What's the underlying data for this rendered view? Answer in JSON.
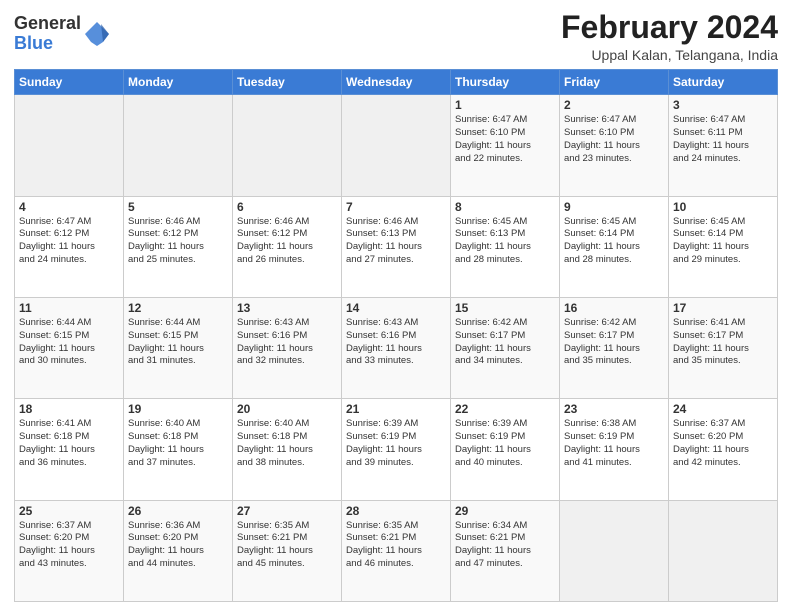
{
  "header": {
    "logo": {
      "general": "General",
      "blue": "Blue"
    },
    "title": "February 2024",
    "subtitle": "Uppal Kalan, Telangana, India"
  },
  "calendar": {
    "days_of_week": [
      "Sunday",
      "Monday",
      "Tuesday",
      "Wednesday",
      "Thursday",
      "Friday",
      "Saturday"
    ],
    "weeks": [
      [
        {
          "day": "",
          "info": ""
        },
        {
          "day": "",
          "info": ""
        },
        {
          "day": "",
          "info": ""
        },
        {
          "day": "",
          "info": ""
        },
        {
          "day": "1",
          "info": "Sunrise: 6:47 AM\nSunset: 6:10 PM\nDaylight: 11 hours\nand 22 minutes."
        },
        {
          "day": "2",
          "info": "Sunrise: 6:47 AM\nSunset: 6:10 PM\nDaylight: 11 hours\nand 23 minutes."
        },
        {
          "day": "3",
          "info": "Sunrise: 6:47 AM\nSunset: 6:11 PM\nDaylight: 11 hours\nand 24 minutes."
        }
      ],
      [
        {
          "day": "4",
          "info": "Sunrise: 6:47 AM\nSunset: 6:12 PM\nDaylight: 11 hours\nand 24 minutes."
        },
        {
          "day": "5",
          "info": "Sunrise: 6:46 AM\nSunset: 6:12 PM\nDaylight: 11 hours\nand 25 minutes."
        },
        {
          "day": "6",
          "info": "Sunrise: 6:46 AM\nSunset: 6:12 PM\nDaylight: 11 hours\nand 26 minutes."
        },
        {
          "day": "7",
          "info": "Sunrise: 6:46 AM\nSunset: 6:13 PM\nDaylight: 11 hours\nand 27 minutes."
        },
        {
          "day": "8",
          "info": "Sunrise: 6:45 AM\nSunset: 6:13 PM\nDaylight: 11 hours\nand 28 minutes."
        },
        {
          "day": "9",
          "info": "Sunrise: 6:45 AM\nSunset: 6:14 PM\nDaylight: 11 hours\nand 28 minutes."
        },
        {
          "day": "10",
          "info": "Sunrise: 6:45 AM\nSunset: 6:14 PM\nDaylight: 11 hours\nand 29 minutes."
        }
      ],
      [
        {
          "day": "11",
          "info": "Sunrise: 6:44 AM\nSunset: 6:15 PM\nDaylight: 11 hours\nand 30 minutes."
        },
        {
          "day": "12",
          "info": "Sunrise: 6:44 AM\nSunset: 6:15 PM\nDaylight: 11 hours\nand 31 minutes."
        },
        {
          "day": "13",
          "info": "Sunrise: 6:43 AM\nSunset: 6:16 PM\nDaylight: 11 hours\nand 32 minutes."
        },
        {
          "day": "14",
          "info": "Sunrise: 6:43 AM\nSunset: 6:16 PM\nDaylight: 11 hours\nand 33 minutes."
        },
        {
          "day": "15",
          "info": "Sunrise: 6:42 AM\nSunset: 6:17 PM\nDaylight: 11 hours\nand 34 minutes."
        },
        {
          "day": "16",
          "info": "Sunrise: 6:42 AM\nSunset: 6:17 PM\nDaylight: 11 hours\nand 35 minutes."
        },
        {
          "day": "17",
          "info": "Sunrise: 6:41 AM\nSunset: 6:17 PM\nDaylight: 11 hours\nand 35 minutes."
        }
      ],
      [
        {
          "day": "18",
          "info": "Sunrise: 6:41 AM\nSunset: 6:18 PM\nDaylight: 11 hours\nand 36 minutes."
        },
        {
          "day": "19",
          "info": "Sunrise: 6:40 AM\nSunset: 6:18 PM\nDaylight: 11 hours\nand 37 minutes."
        },
        {
          "day": "20",
          "info": "Sunrise: 6:40 AM\nSunset: 6:18 PM\nDaylight: 11 hours\nand 38 minutes."
        },
        {
          "day": "21",
          "info": "Sunrise: 6:39 AM\nSunset: 6:19 PM\nDaylight: 11 hours\nand 39 minutes."
        },
        {
          "day": "22",
          "info": "Sunrise: 6:39 AM\nSunset: 6:19 PM\nDaylight: 11 hours\nand 40 minutes."
        },
        {
          "day": "23",
          "info": "Sunrise: 6:38 AM\nSunset: 6:19 PM\nDaylight: 11 hours\nand 41 minutes."
        },
        {
          "day": "24",
          "info": "Sunrise: 6:37 AM\nSunset: 6:20 PM\nDaylight: 11 hours\nand 42 minutes."
        }
      ],
      [
        {
          "day": "25",
          "info": "Sunrise: 6:37 AM\nSunset: 6:20 PM\nDaylight: 11 hours\nand 43 minutes."
        },
        {
          "day": "26",
          "info": "Sunrise: 6:36 AM\nSunset: 6:20 PM\nDaylight: 11 hours\nand 44 minutes."
        },
        {
          "day": "27",
          "info": "Sunrise: 6:35 AM\nSunset: 6:21 PM\nDaylight: 11 hours\nand 45 minutes."
        },
        {
          "day": "28",
          "info": "Sunrise: 6:35 AM\nSunset: 6:21 PM\nDaylight: 11 hours\nand 46 minutes."
        },
        {
          "day": "29",
          "info": "Sunrise: 6:34 AM\nSunset: 6:21 PM\nDaylight: 11 hours\nand 47 minutes."
        },
        {
          "day": "",
          "info": ""
        },
        {
          "day": "",
          "info": ""
        }
      ]
    ]
  }
}
